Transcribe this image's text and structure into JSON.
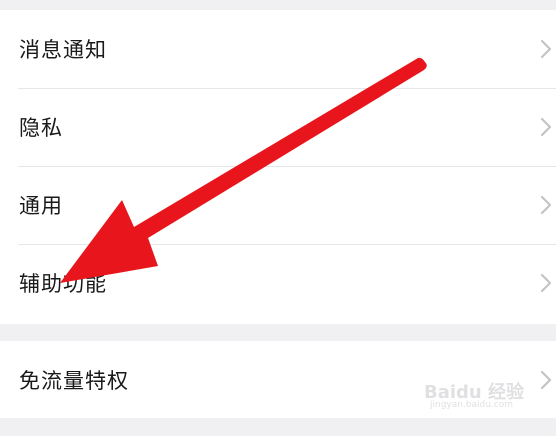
{
  "settings": {
    "items": [
      {
        "label": "消息通知"
      },
      {
        "label": "隐私"
      },
      {
        "label": "通用"
      },
      {
        "label": "辅助功能"
      }
    ],
    "extra": [
      {
        "label": "免流量特权"
      }
    ]
  },
  "annotation": {
    "arrow_color": "#e8161c",
    "icon": "red-arrow-pointer"
  },
  "watermark": {
    "logo_text": "Baidu 经验",
    "sub_text": "jingyan.baidu.com"
  },
  "colors": {
    "background": "#f0f0f2",
    "row_background": "#ffffff",
    "divider": "#e6e6e8",
    "text": "#1a1a1a",
    "chevron": "#c4c4c6"
  }
}
